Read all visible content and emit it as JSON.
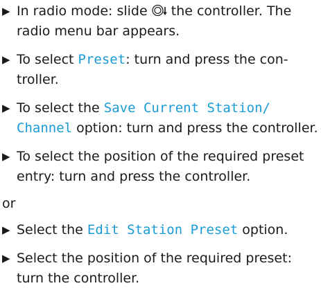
{
  "steps": [
    {
      "parts": [
        {
          "t": "In radio mode: slide "
        },
        {
          "icon": "controller-slide-down-icon"
        },
        {
          "t": " the controller. The radio menu bar appears."
        }
      ]
    },
    {
      "parts": [
        {
          "t": "To select "
        },
        {
          "hl": "Preset"
        },
        {
          "t": ": turn and press the con­troller."
        }
      ]
    },
    {
      "parts": [
        {
          "t": "To select the "
        },
        {
          "hl": "Save Current Station/ Channel"
        },
        {
          "t": " option: turn and press the con­troller."
        }
      ]
    },
    {
      "parts": [
        {
          "t": "To select the position of the required preset entry: turn and press the controller."
        }
      ]
    }
  ],
  "or_label": "or",
  "steps_after": [
    {
      "parts": [
        {
          "t": "Select the "
        },
        {
          "hl": "Edit Station Preset"
        },
        {
          "t": " option."
        }
      ]
    },
    {
      "parts": [
        {
          "t": "Select the position of the required preset: turn the controller."
        }
      ]
    }
  ],
  "bullet_glyph": "▶",
  "colors": {
    "highlight": "#1a9bd7",
    "text": "#1a1a1a"
  }
}
